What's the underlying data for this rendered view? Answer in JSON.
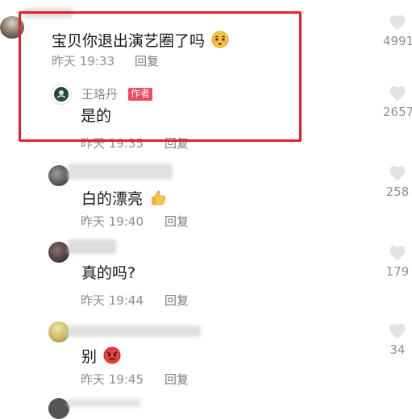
{
  "comments": [
    {
      "text": "宝贝你退出演艺圈了吗",
      "emoji": "pleading-face",
      "time": "昨天 19:33",
      "reply_label": "回复",
      "likes": "4991"
    },
    {
      "author": "王珞丹",
      "author_badge": "作者",
      "text": "是的",
      "time": "昨天 19:35",
      "reply_label": "回复",
      "likes": "2657"
    },
    {
      "text": "白的漂亮",
      "emoji": "thumbs-up",
      "time": "昨天 19:40",
      "reply_label": "回复",
      "likes": "258"
    },
    {
      "text": "真的吗?",
      "time": "昨天 19:44",
      "reply_label": "回复",
      "likes": "179"
    },
    {
      "text": "别",
      "emoji": "angry-face",
      "time": "昨天 19:45",
      "reply_label": "回复",
      "likes": "34"
    }
  ],
  "highlight_color": "#e0222a",
  "like_icon": "heart-icon",
  "badge_color": "#f04a5a"
}
